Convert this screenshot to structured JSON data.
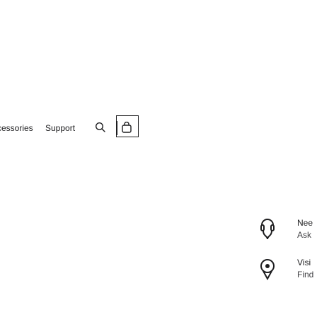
{
  "nav": {
    "accessories": "cessories",
    "support": "Support"
  },
  "help": [
    {
      "title": "Nee",
      "subtitle": "Ask",
      "icon": "headset-icon"
    },
    {
      "title": "Visi",
      "subtitle": "Find",
      "icon": "location-pin-icon"
    }
  ],
  "colors": {
    "text": "#1d1d1f",
    "secondary": "#424245",
    "background": "#ffffff"
  }
}
